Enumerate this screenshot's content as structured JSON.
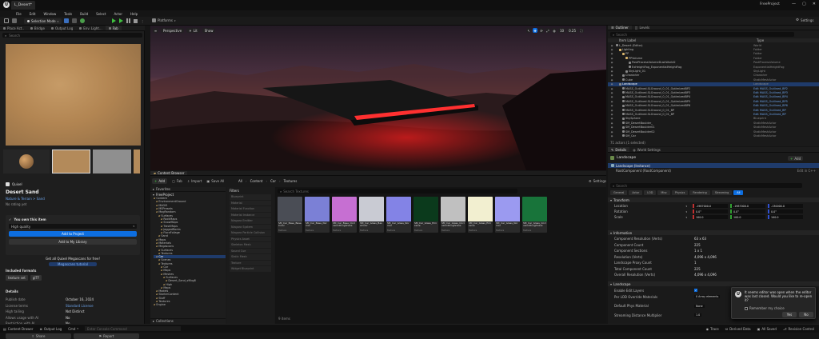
{
  "window": {
    "project_tab": "L_Desert*",
    "menu": [
      "File",
      "Edit",
      "Window",
      "Tools",
      "Build",
      "Select",
      "Actor",
      "Help"
    ],
    "project_name": "FreeProject",
    "mode": "Selection Mode",
    "platforms": "Platforms",
    "settings": "Settings"
  },
  "left": {
    "tabs": [
      "Place Act..",
      "Bridge",
      "Output Log",
      "Env. Light...",
      "Fab"
    ],
    "search_placeholder": "Search",
    "brand": "Quixel",
    "asset_title": "Desert Sand",
    "breadcrumb": "Nature & Terrain > Sand",
    "rating": "No rating yet",
    "own_heading": "You own this item",
    "quality": "High quality",
    "add_to_project": "Add to Project",
    "add_to_library": "Add to My Library",
    "quixel_promo": "Get all Quixel Megascans for free!",
    "megascans_tutorial": "Megascans tutorial",
    "included_formats_label": "Included formats",
    "formats": [
      "texture set",
      "glTF"
    ],
    "details_label": "Details",
    "details": [
      {
        "k": "Publish date",
        "v": "October 16, 2024"
      },
      {
        "k": "License terms",
        "v": "Standard License"
      },
      {
        "k": "High tailing",
        "v": "Not Distinct"
      },
      {
        "k": "Allows usage with AI",
        "v": "No"
      },
      {
        "k": "Restriction with AI",
        "v": "No"
      }
    ],
    "share": "Share",
    "report": "Report"
  },
  "viewport": {
    "perspective": "Perspective",
    "lit": "Lit",
    "show": "Show",
    "fps": "0.25",
    "grid": "10"
  },
  "content_browser": {
    "tab": "Content Browser",
    "add": "Add",
    "import": "Import",
    "fab": "Fab",
    "save_all": "Save All",
    "path": [
      "All",
      "Content",
      "Car",
      "Textures"
    ],
    "settings": "Settings",
    "favorites": "Favorites",
    "root": "FreeProject",
    "search_placeholder": "Search Textures",
    "filters_label": "Filters",
    "filters": [
      "Blueprint",
      "Material",
      "Material Function",
      "Material Instance",
      "Niagara Emitter",
      "Niagara System",
      "Niagara Particle Collision",
      "Physics Asset",
      "Skeleton Mesh",
      "Sound Cue",
      "Static Mesh",
      "Texture",
      "Widget Blueprint"
    ],
    "tree": [
      "Content",
      "EnvironmentGround",
      "MAGIS",
      "MSPresets",
      "MagRandom",
      "Surfaces",
      "RockMaps",
      "SnowMaps",
      "TrashMaps",
      "JaggedRocks",
      "FloraFoliage",
      "Sand",
      "Maps",
      "Materials",
      "Megascans",
      "Surfaces",
      "Textures",
      "Car",
      "Scenes",
      "Textures",
      "Car",
      "Maps",
      "Meshes",
      "Surfaces",
      "Desert_Sand_s9lbg8",
      "High",
      "Maps",
      "Models",
      "StarterContent",
      "Stuff",
      "Textures",
      "Engine"
    ],
    "collections": "Collections",
    "item_count": "9 items",
    "items": [
      {
        "name": "SM_Car_Base_BaseColor",
        "type": "Texture",
        "color": "#4a4d55"
      },
      {
        "name": "SM_Car_Base_Normal",
        "type": "Texture",
        "color": "#7b80d6"
      },
      {
        "name": "SM_Car_Base_OcclusionRoughness",
        "type": "Texture",
        "color": "#c66fd2"
      },
      {
        "name": "SM_Car_Glass_BaseColor",
        "type": "Texture",
        "color": "#c9cbd3"
      },
      {
        "name": "SM_Car_Glass_Normal",
        "type": "Texture",
        "color": "#8383e6"
      },
      {
        "name": "SM_Car_Glass_Emissive",
        "type": "Texture",
        "color": "#0b3a1c"
      },
      {
        "name": "SM_Car_Glass_OcclusionRoughness",
        "type": "Texture",
        "color": "#c0c0c0"
      },
      {
        "name": "SM_Car_Glass_Emissive",
        "type": "Texture",
        "color": "#f2efd0"
      },
      {
        "name": "SM_Car_Glass_Normal",
        "type": "Texture",
        "color": "#9b9af0"
      },
      {
        "name": "SM_Car_Glass_OcclusionRoughness",
        "type": "Texture",
        "color": "#18743a"
      }
    ]
  },
  "outliner": {
    "tab": "Outliner",
    "levels_tab": "Levels",
    "search_placeholder": "Search",
    "col_label": "Item Label",
    "col_type": "Type",
    "rows": [
      {
        "indent": 0,
        "label": "L_Desert (Editor)",
        "type": "World"
      },
      {
        "indent": 1,
        "label": "Lighting",
        "type": "Folder"
      },
      {
        "indent": 2,
        "label": "PP",
        "type": "Folder"
      },
      {
        "indent": 3,
        "label": "PPVolume",
        "type": "Folder"
      },
      {
        "indent": 4,
        "label": "PostProcessVolumeDuskWorld2",
        "type": "PostProcessVolume"
      },
      {
        "indent": 4,
        "label": "ExHeightFog_ExponentialHeightFog",
        "type": "ExponentialHeightFog"
      },
      {
        "indent": 3,
        "label": "SkyLight_01",
        "type": "SkyLight"
      },
      {
        "indent": 2,
        "label": "Character",
        "type": "Character"
      },
      {
        "indent": 2,
        "label": "Cube",
        "type": "StaticMeshActor"
      },
      {
        "indent": 1,
        "label": "Landscape",
        "type": "Landscape",
        "selected": true
      },
      {
        "indent": 2,
        "label": "MASS_Outlined.SLGround_0_01_OptimizedBP2",
        "type": "Edit MASS_Outlined_BP2"
      },
      {
        "indent": 2,
        "label": "MASS_Outlined.SLGround_0_01_OptimizedBP3",
        "type": "Edit MASS_Outlined_BP3"
      },
      {
        "indent": 2,
        "label": "MASS_Outlined.SLGround_0_01_OptimizedBP4",
        "type": "Edit MASS_Outlined_BP4"
      },
      {
        "indent": 2,
        "label": "MASS_Outlined.SLGround_0_01_OptimizedBP5",
        "type": "Edit MASS_Outlined_BP5"
      },
      {
        "indent": 2,
        "label": "MASS_Outlined.SLGround_0_01_OptimizedBP6",
        "type": "Edit MASS_Outlined_BP6"
      },
      {
        "indent": 2,
        "label": "MASS_Outlined.SLGround_0_01_BP",
        "type": "Edit MASS_Outlined_BP"
      },
      {
        "indent": 2,
        "label": "MASS_Outlined.SLGround_0_01_BP",
        "type": "Edit MASS_Outlined_BP"
      },
      {
        "indent": 2,
        "label": "SkySphere",
        "type": "Blueprint"
      },
      {
        "indent": 2,
        "label": "SM_DesertBoulder_",
        "type": "StaticMeshActor"
      },
      {
        "indent": 2,
        "label": "SM_DesertBoulder01",
        "type": "StaticMeshActor"
      },
      {
        "indent": 2,
        "label": "SM_DesertBoulder02",
        "type": "StaticMeshActor"
      },
      {
        "indent": 2,
        "label": "SM_Car",
        "type": "StaticMeshActor"
      }
    ],
    "status": "71 actors (1 selected)"
  },
  "details": {
    "tab": "Details",
    "world_settings_tab": "World Settings",
    "actor_name": "Landscape",
    "add": "Add",
    "instance": "Landscape (Instance)",
    "root": "RootComponent (RootComponent)",
    "edit_cpp": "Edit in C++",
    "search_placeholder": "Search",
    "categories": [
      "General",
      "Actor",
      "LOD",
      "Misc",
      "Physics",
      "Rendering",
      "Streaming",
      "All"
    ],
    "transform_label": "Transform",
    "transform": [
      {
        "label": "Location",
        "x": "-1987000.0",
        "y": "-1987000.0",
        "z": "-130000.0"
      },
      {
        "label": "Rotation",
        "x": "0.0°",
        "y": "0.0°",
        "z": "0.0°"
      },
      {
        "label": "Scale",
        "x": "100.0",
        "y": "100.0",
        "z": "100.0"
      }
    ],
    "information_label": "Information",
    "info": [
      {
        "k": "Component Resolution (Verts)",
        "v": "63 x 63"
      },
      {
        "k": "Component Count",
        "v": "225"
      },
      {
        "k": "Component Sections",
        "v": "1 x 1"
      },
      {
        "k": "Resolution (Verts)",
        "v": "4,096 x 4,096"
      },
      {
        "k": "Landscape Proxy Count",
        "v": "1"
      },
      {
        "k": "Total Component Count",
        "v": "225"
      },
      {
        "k": "Overall Resolution (Verts)",
        "v": "4,096 x 4,096"
      }
    ],
    "landscape_label": "Landscape",
    "landscape": [
      {
        "k": "Enable Edit Layers",
        "v": "checked"
      },
      {
        "k": "Per LOD Override Materials",
        "v": "0 Array elements"
      },
      {
        "k": "Default Phys Material",
        "v": "None"
      },
      {
        "k": "Streaming Distance Multiplier",
        "v": "1.0"
      }
    ]
  },
  "dialog": {
    "message": "It seems editor was open when the editor was last closed. Would you like to re-open it?",
    "remember": "Remember my choice",
    "yes": "Yes",
    "no": "No"
  },
  "statusbar": {
    "content_drawer": "Content Drawer",
    "output_log": "Output Log",
    "cmd": "Cmd",
    "cmd_placeholder": "Enter Console Command",
    "trace": "Trace",
    "derived_data": "Derived Data",
    "all_saved": "All Saved",
    "revision_control": "Revision Control"
  },
  "colors": {
    "selected": "#1f3b6b",
    "accent_blue": "#0d6ee0",
    "play_green": "#3fbf3f",
    "dialog_bg": "#252525"
  }
}
